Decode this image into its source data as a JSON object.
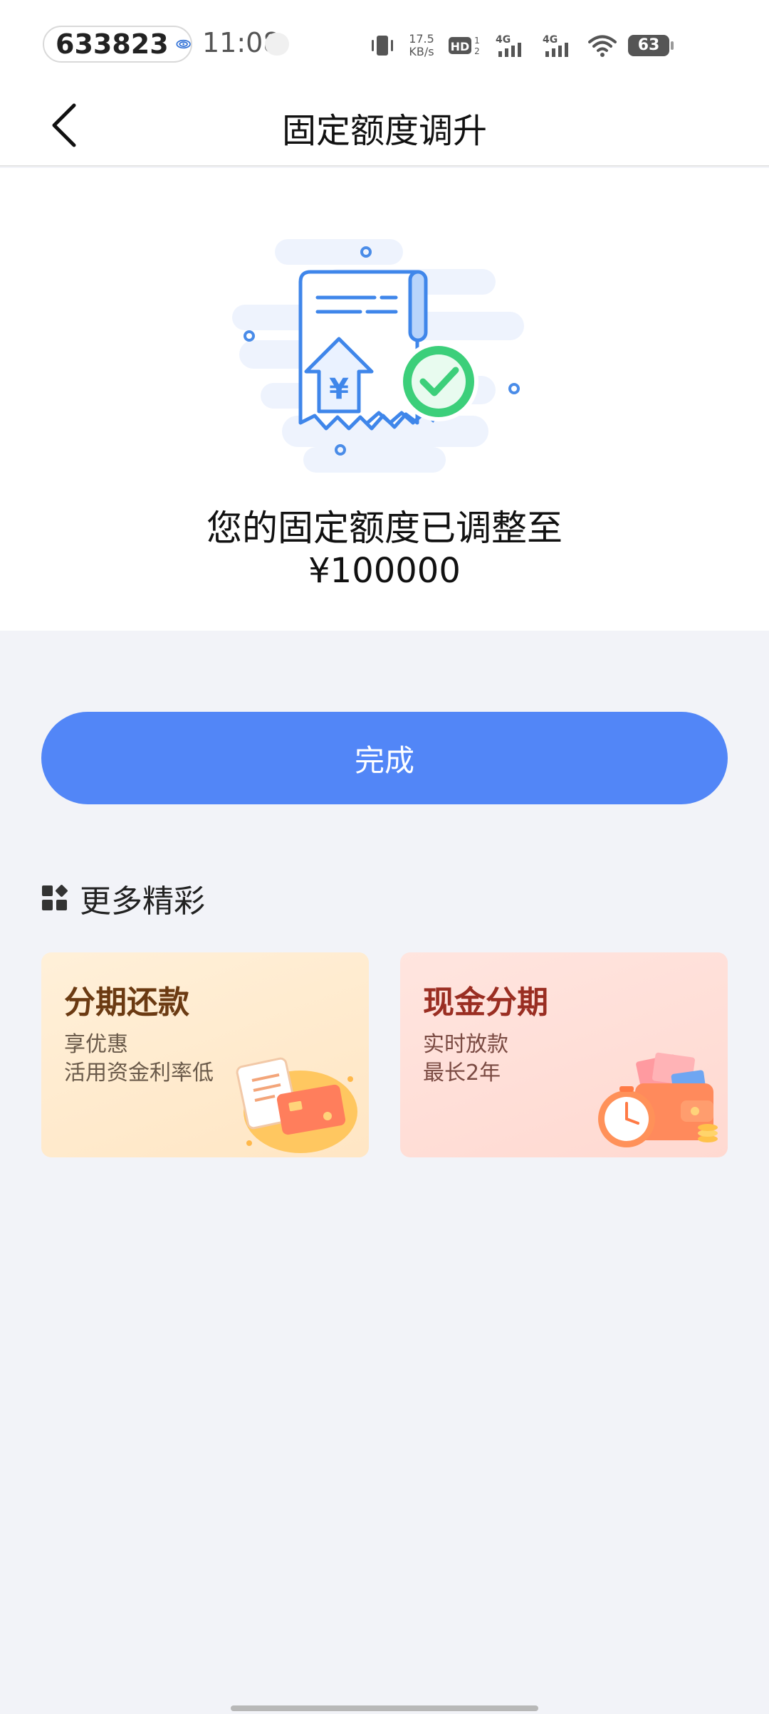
{
  "status_bar": {
    "pill_text": "633823",
    "time": "11:08",
    "net_speed_value": "17.5",
    "net_speed_unit": "KB/s",
    "battery": "63"
  },
  "nav": {
    "title": "固定额度调升"
  },
  "result": {
    "message": "您的固定额度已调整至",
    "amount": "¥100000"
  },
  "done_button": {
    "label": "完成"
  },
  "more": {
    "title": "更多精彩",
    "cards": [
      {
        "title": "分期还款",
        "line1": "享优惠",
        "line2": "活用资金利率低"
      },
      {
        "title": "现金分期",
        "line1": "实时放款",
        "line2": "最长2年"
      }
    ]
  },
  "colors": {
    "primary": "#5286f7",
    "page_bg": "#f2f3f8",
    "success": "#3ccf7a"
  }
}
